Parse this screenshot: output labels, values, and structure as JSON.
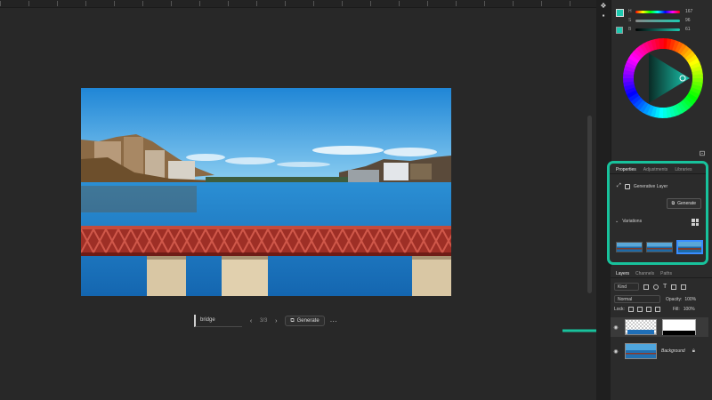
{
  "canvas": {
    "prompt_value": "bridge",
    "variation_counter": "3/3",
    "generate_label": "Generate",
    "more_label": "···"
  },
  "color_panel": {
    "values": [
      "167",
      "96",
      "61"
    ],
    "labels": [
      "H",
      "S",
      "B"
    ],
    "accent_color": "#1ec9b0",
    "highlight_color": "#18c29c"
  },
  "properties": {
    "tabs": [
      "Properties",
      "Adjustments",
      "Libraries"
    ],
    "layer_type": "Generative Layer",
    "generate_label": "Generate",
    "variations_label": "Variations"
  },
  "layers_panel": {
    "tabs": [
      "Layers",
      "Channels",
      "Paths"
    ],
    "filter_kind": "Kind",
    "blend_mode": "Normal",
    "opacity_label": "Opacity:",
    "opacity_value": "100%",
    "lock_label": "Lock:",
    "fill_label": "Fill:",
    "fill_value": "100%",
    "layers": [
      {
        "name": ""
      },
      {
        "name": "Background"
      }
    ]
  },
  "icons": {
    "visibility": "eye-icon",
    "lock": "lock-icon",
    "generate": "sparkle-icon"
  }
}
